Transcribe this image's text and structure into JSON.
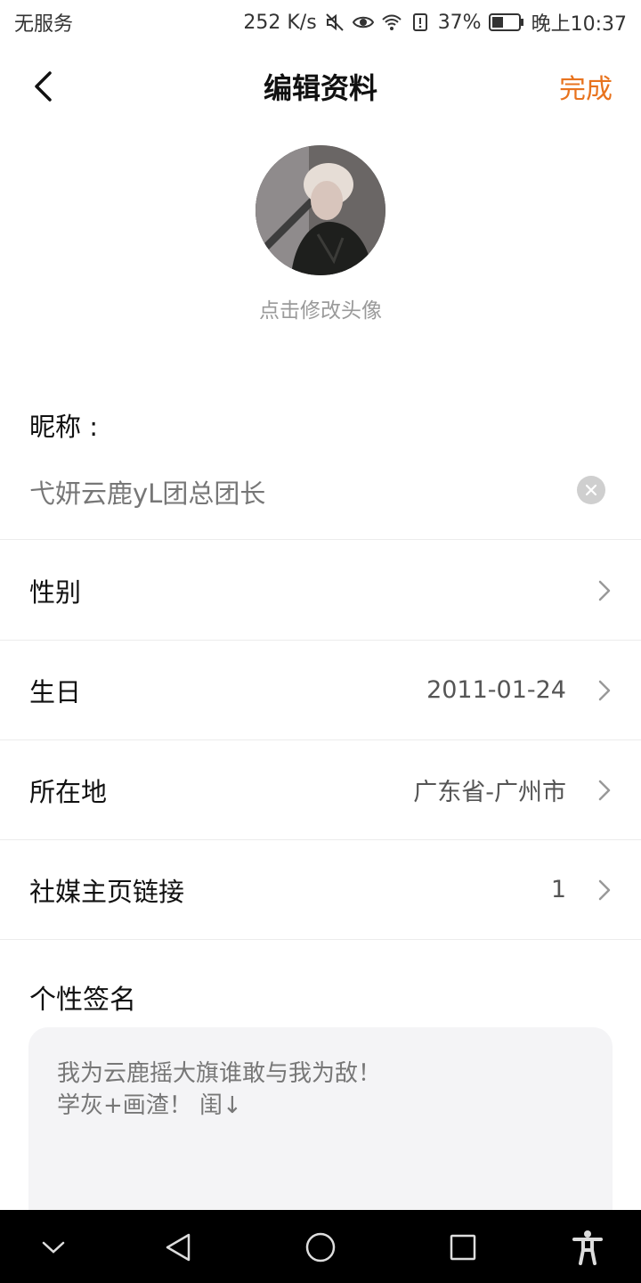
{
  "status_bar": {
    "carrier": "无服务",
    "network_speed": "252 K/s",
    "battery": "37%",
    "time": "晚上10:37",
    "icons": [
      "mute-icon",
      "eye-icon",
      "wifi-icon",
      "battery-alert-icon",
      "battery-icon"
    ]
  },
  "header": {
    "title": "编辑资料",
    "done_label": "完成",
    "back_icon": "chevron-left-icon"
  },
  "avatar": {
    "caption": "点击修改头像"
  },
  "nickname": {
    "label": "昵称 :",
    "value": "弋妍云鹿yL团总团长"
  },
  "rows": [
    {
      "label": "性别",
      "value": ""
    },
    {
      "label": "生日",
      "value": "2011-01-24"
    },
    {
      "label": "所在地",
      "value": "广东省-广州市"
    },
    {
      "label": "社媒主页链接",
      "value": "1"
    }
  ],
  "signature": {
    "label": "个性签名",
    "text": "我为云鹿摇大旗谁敢与我为敌！\n学灰+画渣！ 闺↓"
  },
  "colors": {
    "accent": "#e8731e",
    "nav_background": "#000000"
  }
}
